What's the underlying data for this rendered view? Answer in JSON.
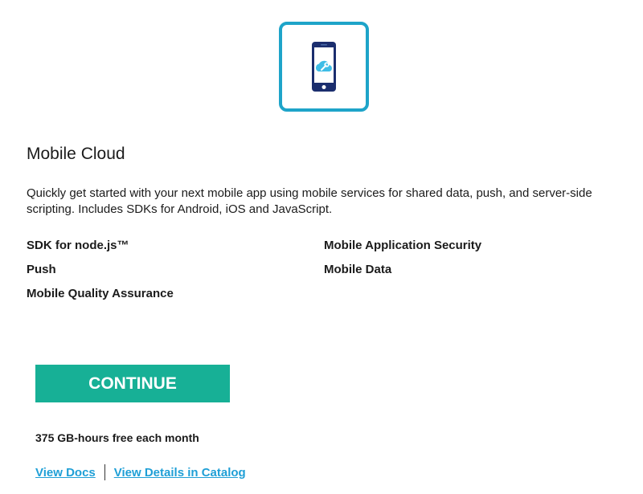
{
  "app_icon": {
    "icon": "mobile-cloud-icon",
    "border_color": "#1ea4c9",
    "phone_color": "#1b2e6e",
    "cloud_color": "#3fbde6"
  },
  "title": "Mobile Cloud",
  "description": "Quickly get started with your next mobile app using mobile services for shared data, push, and server-side scripting. Includes SDKs for Android, iOS and JavaScript.",
  "services": [
    "SDK for node.js™",
    "Mobile Application Security",
    "Push",
    "Mobile Data",
    "Mobile Quality Assurance"
  ],
  "continue_button": {
    "label": "CONTINUE",
    "color": "#17b096"
  },
  "pricing": "375 GB-hours free each month",
  "links": {
    "docs": "View Docs",
    "catalog": "View Details in Catalog",
    "color": "#1f9fd6"
  }
}
